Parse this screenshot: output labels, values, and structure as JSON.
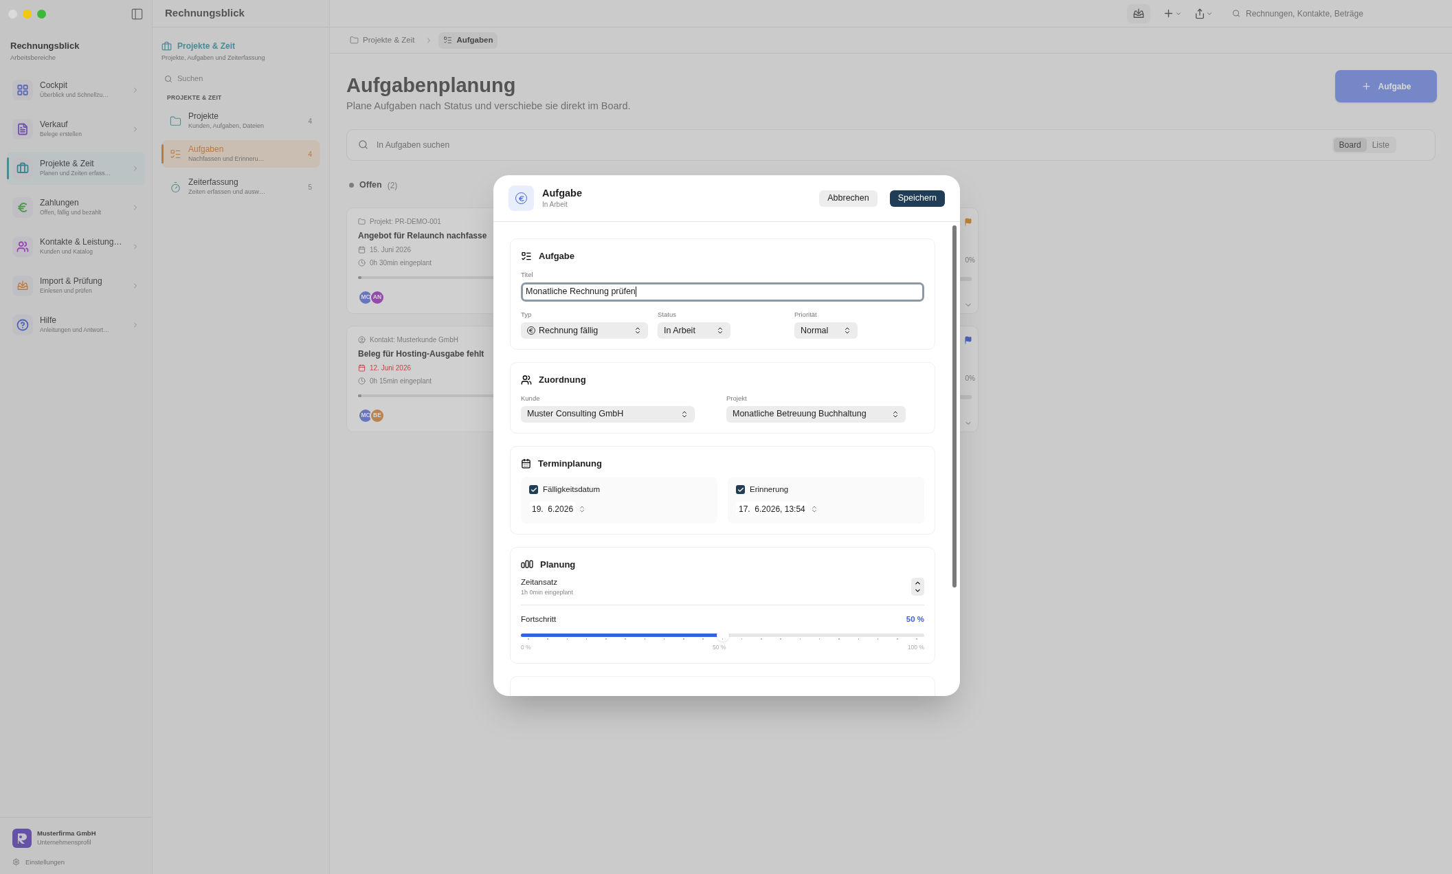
{
  "window": {
    "title": "Rechnungsblick"
  },
  "sidebar": {
    "title": "Rechnungsblick",
    "subtitle": "Arbeitsbereiche",
    "items": [
      {
        "title": "Cockpit",
        "subtitle": "Überblick und Schnellzu…",
        "selected": false,
        "color": "#5b68bd"
      },
      {
        "title": "Verkauf",
        "subtitle": "Belege erstellen",
        "selected": false,
        "color": "#7151ac"
      },
      {
        "title": "Projekte & Zeit",
        "subtitle": "Planen und Zeiten erfass…",
        "selected": true,
        "color": "#3d8290"
      },
      {
        "title": "Zahlungen",
        "subtitle": "Offen, fällig und bezahlt",
        "selected": false,
        "color": "#4b974b"
      },
      {
        "title": "Kontakte & Leistung…",
        "subtitle": "Kunden und Katalog",
        "selected": false,
        "color": "#9446b0"
      },
      {
        "title": "Import & Prüfung",
        "subtitle": "Einlesen und prüfen",
        "selected": false,
        "color": "#ba7a3d"
      },
      {
        "title": "Hilfe",
        "subtitle": "Anleitungen und Antwort…",
        "selected": false,
        "color": "#4b63b8"
      }
    ],
    "company": {
      "name": "Musterfirma GmbH",
      "subtitle": "Unternehmensprofil"
    },
    "settings": "Einstellungen"
  },
  "subnav": {
    "title": "Projekte & Zeit",
    "subtitle": "Projekte, Aufgaben und Zeiterfassung",
    "search": {
      "placeholder": "Suchen"
    },
    "section": "PROJEKTE & ZEIT",
    "items": [
      {
        "title": "Projekte",
        "subtitle": "Kunden, Aufgaben, Dateien",
        "count": "4",
        "selected": false
      },
      {
        "title": "Aufgaben",
        "subtitle": "Nachfassen und Erinneru…",
        "count": "4",
        "selected": true
      },
      {
        "title": "Zeiterfassung",
        "subtitle": "Zeiten erfassen und ausw…",
        "count": "5",
        "selected": false
      }
    ]
  },
  "toolbar": {
    "search": {
      "placeholder": "Rechnungen, Kontakte, Beträge"
    }
  },
  "breadcrumb": [
    {
      "label": "Projekte & Zeit",
      "selected": false
    },
    {
      "label": "Aufgaben",
      "selected": true
    }
  ],
  "header": {
    "title": "Aufgabenplanung",
    "subtitle": "Plane Aufgaben nach Status und verschiebe sie direkt im Board.",
    "add_button": "Aufgabe"
  },
  "board_search": {
    "placeholder": "In Aufgaben suchen"
  },
  "view_tabs": [
    {
      "label": "Board",
      "selected": true
    },
    {
      "label": "Liste",
      "selected": false
    }
  ],
  "columns": [
    {
      "title": "Offen",
      "count": "(2)",
      "cards": [
        {
          "kind": "project",
          "context": "Projekt: PR-DEMO-001",
          "title": "Angebot für Relaunch nachfasse",
          "date": "15. Juni 2026",
          "overdue": false,
          "planned": "0h 30min eingeplant",
          "level": 0,
          "avatars": [
            {
              "initials": "MC",
              "color": "#6874bd"
            },
            {
              "initials": "AN",
              "color": "#944aab"
            }
          ]
        },
        {
          "kind": "contact",
          "context": "Kontakt: Musterkunde GmbH",
          "title": "Beleg für Hosting-Ausgabe fehlt",
          "date": "12. Juni 2026",
          "overdue": true,
          "planned": "0h 15min eingeplant",
          "level": 0,
          "avatars": [
            {
              "initials": "MC",
              "color": "#6874bd"
            },
            {
              "initials": "BE",
              "color": "#b88350"
            }
          ]
        }
      ]
    },
    {
      "cards": [
        {
          "color": "#be8430",
          "progress": "0%",
          "level": 0
        },
        {
          "color": "#4b63b8",
          "progress": "0%",
          "level": 0
        }
      ]
    }
  ],
  "dialog": {
    "title": "Aufgabe",
    "subtitle": "In Arbeit",
    "cancel": "Abbrechen",
    "save": "Speichern",
    "task_section": {
      "heading": "Aufgabe",
      "title_label": "Titel",
      "title_value": "Monatliche Rechnung prüfen",
      "fields": [
        {
          "label": "Typ",
          "value": "Rechnung fällig"
        },
        {
          "label": "Status",
          "value": "In Arbeit"
        },
        {
          "label": "Priorität",
          "value": "Normal"
        }
      ]
    },
    "assignment_section": {
      "heading": "Zuordnung",
      "fields": [
        {
          "label": "Kunde",
          "value": "Muster Consulting GmbH"
        },
        {
          "label": "Projekt",
          "value": "Monatliche Betreuung Buchhaltung"
        }
      ]
    },
    "schedule_section": {
      "heading": "Terminplanung",
      "items": [
        {
          "label": "Fälligkeitsdatum",
          "checked": true,
          "value": "19.  6.2026"
        },
        {
          "label": "Erinnerung",
          "checked": true,
          "value": "17.  6.2026, 13:54"
        }
      ]
    },
    "planning_section": {
      "heading": "Planung",
      "estimate_label": "Zeitansatz",
      "estimate_value": "1h 0min eingeplant",
      "progress_label": "Fortschritt",
      "progress_value": "50 %",
      "level": 0.5,
      "scale": [
        "0 %",
        "50 %",
        "100 %"
      ]
    }
  }
}
